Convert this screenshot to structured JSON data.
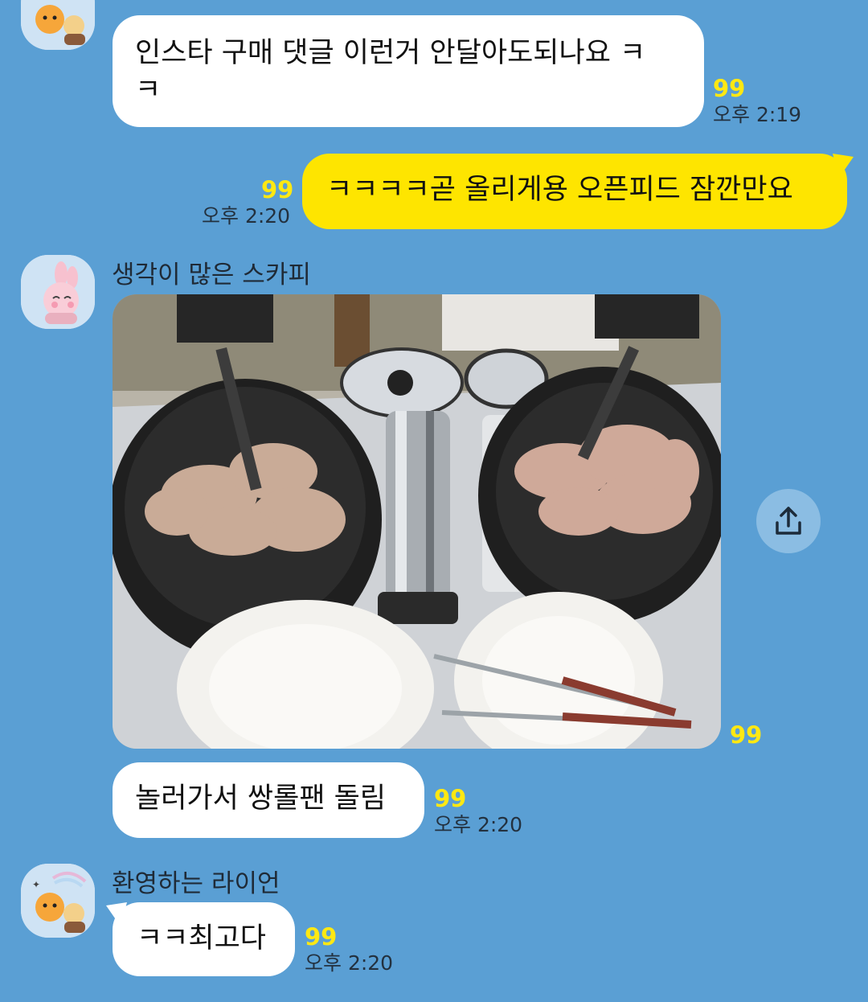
{
  "messages": [
    {
      "id": "m1",
      "lines": [
        "인스타 구매 댓글 이런거 안달아도되나요 ㅋ",
        "ㅋ"
      ],
      "unread": "99",
      "time": "오후 2:19"
    },
    {
      "id": "m2",
      "text": "ㅋㅋㅋㅋ곧 올리게용 오픈피드 잠깐만요",
      "unread": "99",
      "time": "오후 2:20"
    },
    {
      "id": "m3",
      "sender": "생각이 많은 스카피",
      "photo_unread": "99",
      "text": "놀러가서 쌍롤팬 돌림",
      "unread": "99",
      "time": "오후 2:20"
    },
    {
      "id": "m4",
      "sender": "환영하는 라이언",
      "text": "ㅋㅋ최고다",
      "unread": "99",
      "time": "오후 2:20"
    }
  ],
  "icons": {
    "share": "share-icon",
    "avatar_lion": "lion-avatar-icon",
    "avatar_scrappy": "scrappy-avatar-icon"
  },
  "colors": {
    "background": "#5a9fd4",
    "my_bubble": "#fee500",
    "their_bubble": "#ffffff",
    "unread": "#ffe812"
  }
}
